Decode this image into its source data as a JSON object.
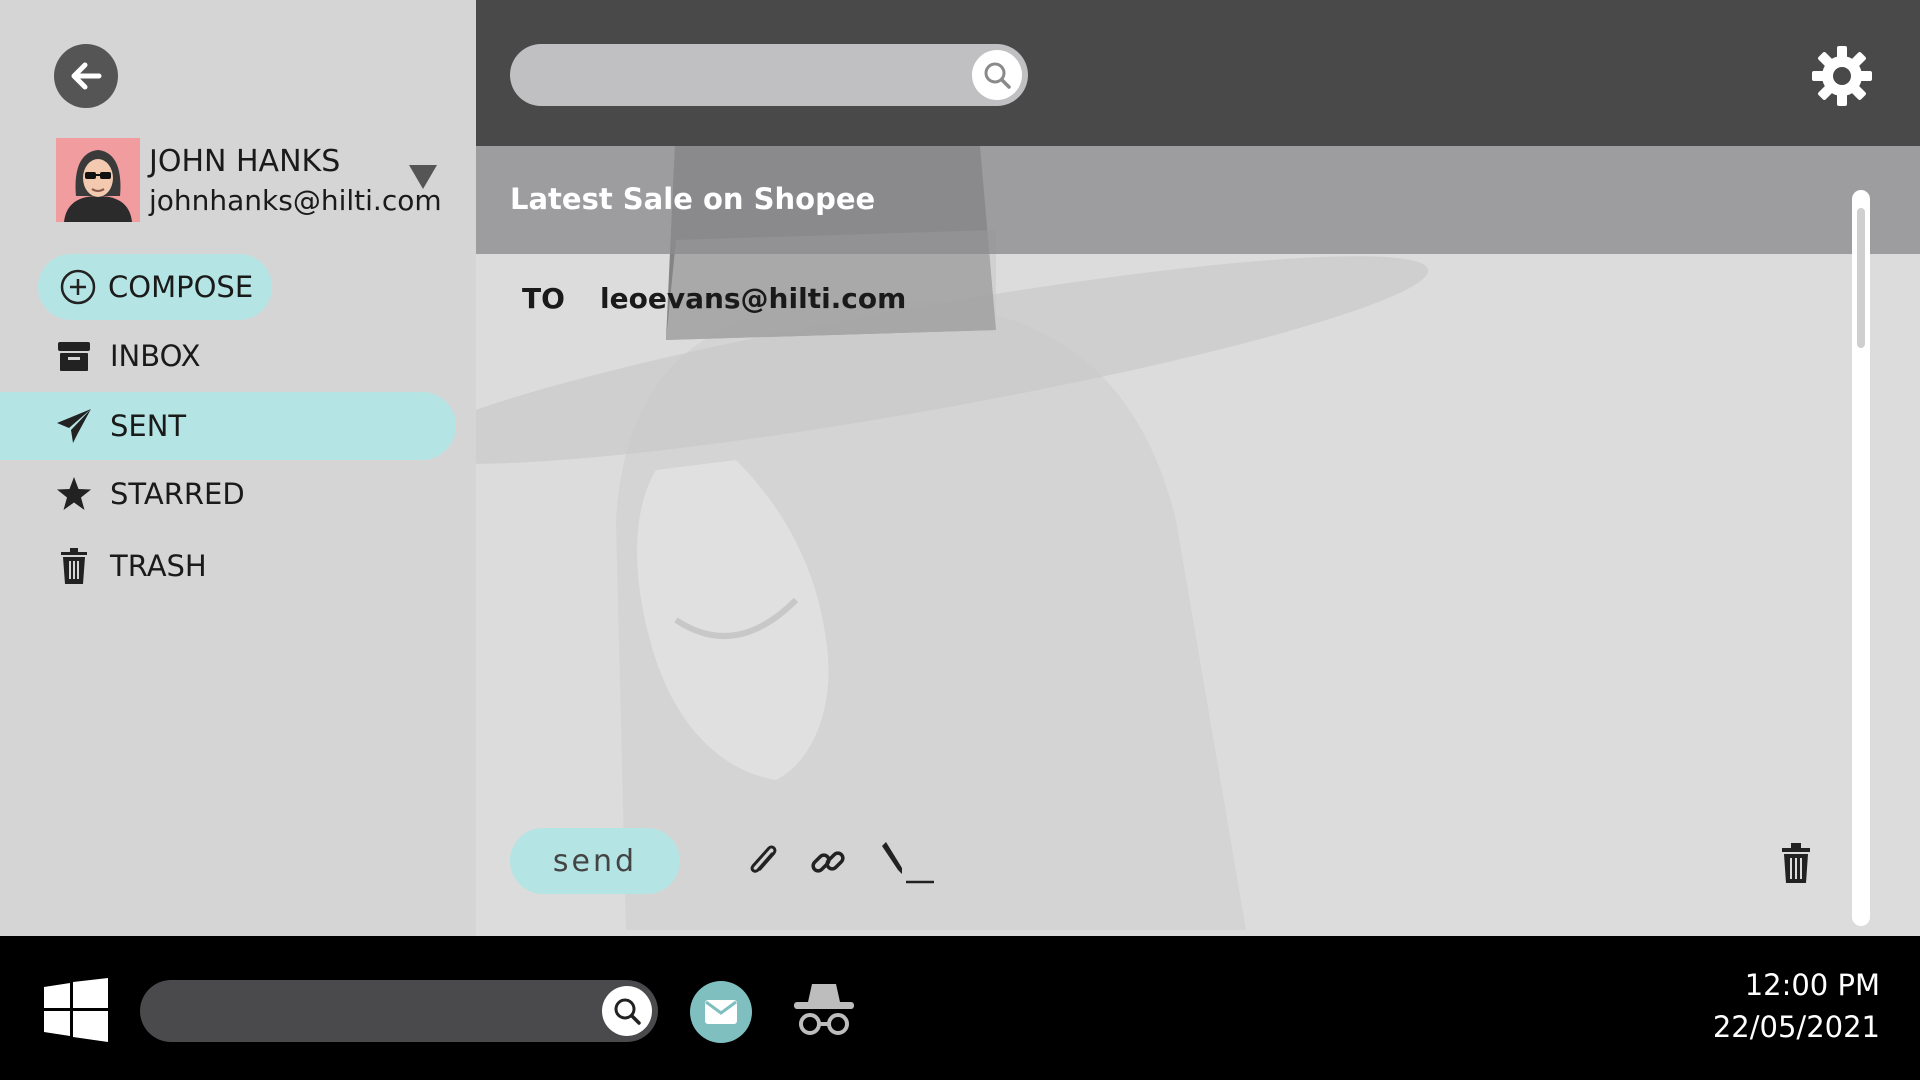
{
  "sidebar": {
    "user": {
      "name": "JOHN HANKS",
      "email": "johnhanks@hilti.com"
    },
    "compose_label": "COMPOSE",
    "items": [
      {
        "label": "INBOX",
        "icon": "inbox-icon"
      },
      {
        "label": "SENT",
        "icon": "send-icon",
        "selected": true
      },
      {
        "label": "STARRED",
        "icon": "star-icon"
      },
      {
        "label": "TRASH",
        "icon": "trash-icon"
      }
    ]
  },
  "header": {
    "search": {
      "value": "",
      "placeholder": ""
    }
  },
  "email": {
    "subject": "Latest Sale on Shopee",
    "to_label": "TO",
    "to_value": "leoevans@hilti.com"
  },
  "actions": {
    "send_label": "send"
  },
  "taskbar": {
    "search": {
      "value": "",
      "placeholder": ""
    },
    "time": "12:00 PM",
    "date": "22/05/2021"
  },
  "colors": {
    "accent": "#b4e5e4",
    "topbar": "#494949",
    "sidebar": "#d5d5d5",
    "taskbar": "#000000"
  }
}
